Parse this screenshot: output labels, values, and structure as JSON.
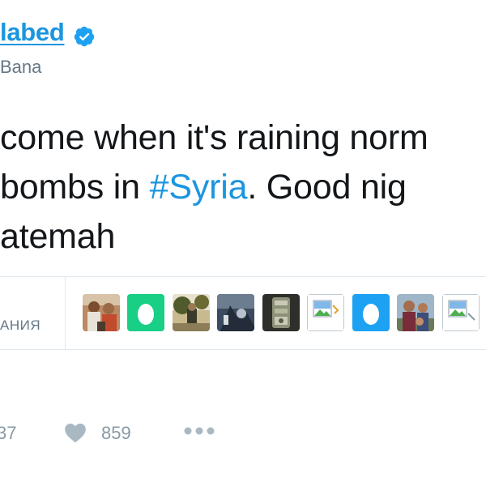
{
  "header": {
    "name": "labed",
    "handle": "Bana"
  },
  "tweet": {
    "line1": "come when it's raining norm",
    "line2_before": "bombs in ",
    "hashtag": "#Syria",
    "line2_after": ". Good nig",
    "line3": "atemah"
  },
  "likes_bar": {
    "label": "АНИЯ",
    "avatars": [
      {
        "kind": "photo",
        "icon": "avatar-photo-people"
      },
      {
        "kind": "egg",
        "color": "#19cf86",
        "icon": "egg-avatar-icon"
      },
      {
        "kind": "photo",
        "icon": "avatar-photo-outdoor"
      },
      {
        "kind": "photo",
        "icon": "avatar-photo-dark"
      },
      {
        "kind": "photo",
        "icon": "avatar-photo-ornament"
      },
      {
        "kind": "broken",
        "icon": "broken-image-icon"
      },
      {
        "kind": "egg",
        "color": "#1da1f2",
        "icon": "egg-avatar-icon"
      },
      {
        "kind": "photo",
        "icon": "avatar-photo-couple"
      },
      {
        "kind": "broken",
        "icon": "broken-image-icon"
      }
    ]
  },
  "actions": {
    "retweet_count": "37",
    "like_count": "859",
    "more_icon": "more-dots-icon",
    "like_icon": "heart-icon"
  },
  "colors": {
    "link": "#1b95e0",
    "text": "#14171a",
    "muted": "#657786",
    "action": "#8899a6",
    "border": "#e1e8ed"
  }
}
